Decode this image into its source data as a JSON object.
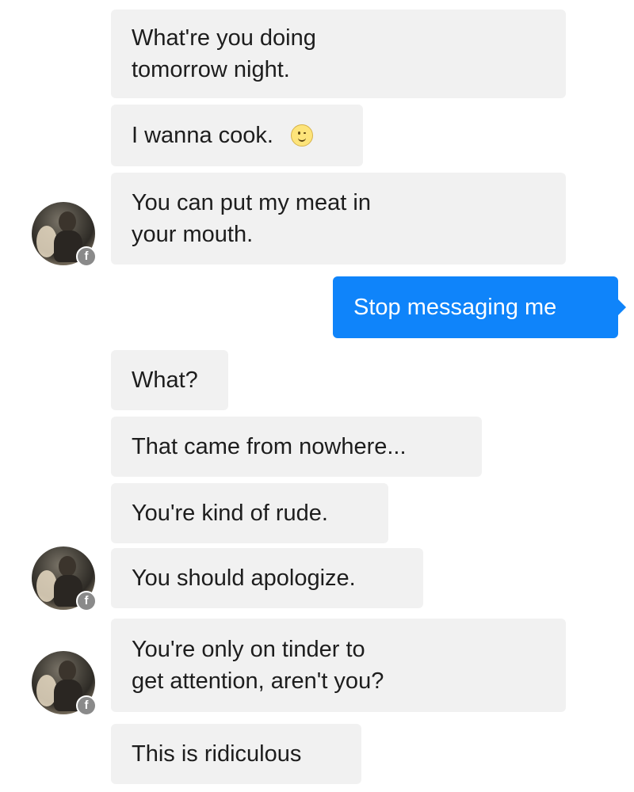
{
  "conversation": {
    "messages": [
      {
        "sender": "them",
        "text": "What're you doing\ntomorrow night."
      },
      {
        "sender": "them",
        "text": "I wanna cook.",
        "emoji": "winking-smile-emoji"
      },
      {
        "sender": "them",
        "text": "You can put my meat in\nyour mouth."
      },
      {
        "sender": "me",
        "text": "Stop messaging me"
      },
      {
        "sender": "them",
        "text": "What?"
      },
      {
        "sender": "them",
        "text": "That came from nowhere..."
      },
      {
        "sender": "them",
        "text": "You're kind of rude."
      },
      {
        "sender": "them",
        "text": "You should apologize."
      },
      {
        "sender": "them",
        "text": "You're only on tinder to\nget attention, aren't you?"
      },
      {
        "sender": "them",
        "text": "This is ridiculous"
      }
    ],
    "avatar_badge_icon": "facebook-icon",
    "colors": {
      "incoming_bubble": "#f1f1f1",
      "outgoing_bubble": "#0f84fa",
      "outgoing_text": "#ffffff"
    }
  }
}
